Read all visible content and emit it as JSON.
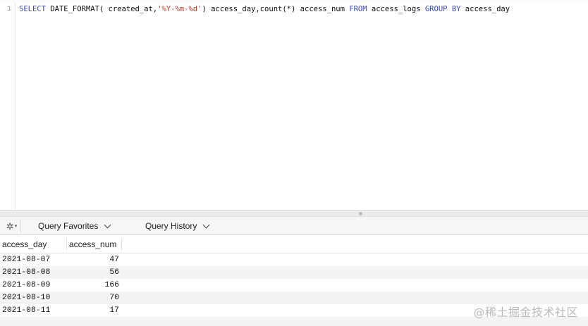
{
  "editor": {
    "line_number": "1",
    "query": {
      "t1": "SELECT",
      "t2": " DATE_FORMAT( created_at,",
      "t3": "'%Y-%m-%d'",
      "t4": ") access_day,count(*) access_num ",
      "t5": "FROM",
      "t6": " access_logs ",
      "t7": "GROUP BY",
      "t8": " access_day"
    }
  },
  "colors": {
    "keyword": "#3b4cc0",
    "string": "#c0392b"
  },
  "toolbar": {
    "gear_icon": "gear-icon",
    "query_favorites_label": "Query Favorites",
    "query_history_label": "Query History"
  },
  "results": {
    "columns": [
      "access_day",
      "access_num"
    ],
    "rows": [
      [
        "2021-08-07",
        "47"
      ],
      [
        "2021-08-08",
        "56"
      ],
      [
        "2021-08-09",
        "166"
      ],
      [
        "2021-08-10",
        "70"
      ],
      [
        "2021-08-11",
        "17"
      ]
    ]
  },
  "watermark": "@稀土掘金技术社区"
}
